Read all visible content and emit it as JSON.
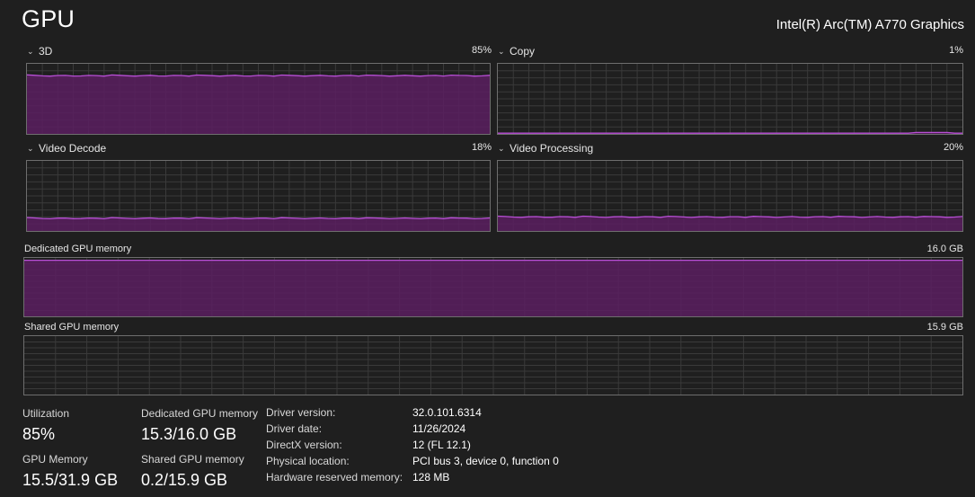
{
  "header": {
    "title": "GPU",
    "device": "Intel(R) Arc(TM) A770 Graphics"
  },
  "colors": {
    "accent": "#b84fd6",
    "fill": "#5b1e60",
    "grid": "#3a3a3a",
    "border": "#6e6e6e",
    "background": "#1f1f1f"
  },
  "engines": [
    {
      "label": "3D",
      "percent_label": "85%",
      "level": 0.83
    },
    {
      "label": "Copy",
      "percent_label": "1%",
      "level": 0.01
    },
    {
      "label": "Video Decode",
      "percent_label": "18%",
      "level": 0.18
    },
    {
      "label": "Video Processing",
      "percent_label": "20%",
      "level": 0.2
    }
  ],
  "memory_graphs": [
    {
      "label": "Dedicated GPU memory",
      "capacity": "16.0 GB",
      "level": 0.96
    },
    {
      "label": "Shared GPU memory",
      "capacity": "15.9 GB",
      "level": 0.0
    }
  ],
  "stats": {
    "utilization": {
      "label": "Utilization",
      "value": "85%"
    },
    "dedicated": {
      "label": "Dedicated GPU memory",
      "value": "15.3/16.0 GB"
    },
    "gpu_memory": {
      "label": "GPU Memory",
      "value": "15.5/31.9 GB"
    },
    "shared": {
      "label": "Shared GPU memory",
      "value": "0.2/15.9 GB"
    }
  },
  "properties": [
    {
      "key": "Driver version:",
      "value": "32.0.101.6314"
    },
    {
      "key": "Driver date:",
      "value": "11/26/2024"
    },
    {
      "key": "DirectX version:",
      "value": "12 (FL 12.1)"
    },
    {
      "key": "Physical location:",
      "value": "PCI bus 3, device 0, function 0"
    },
    {
      "key": "Hardware reserved memory:",
      "value": "128 MB"
    }
  ]
}
